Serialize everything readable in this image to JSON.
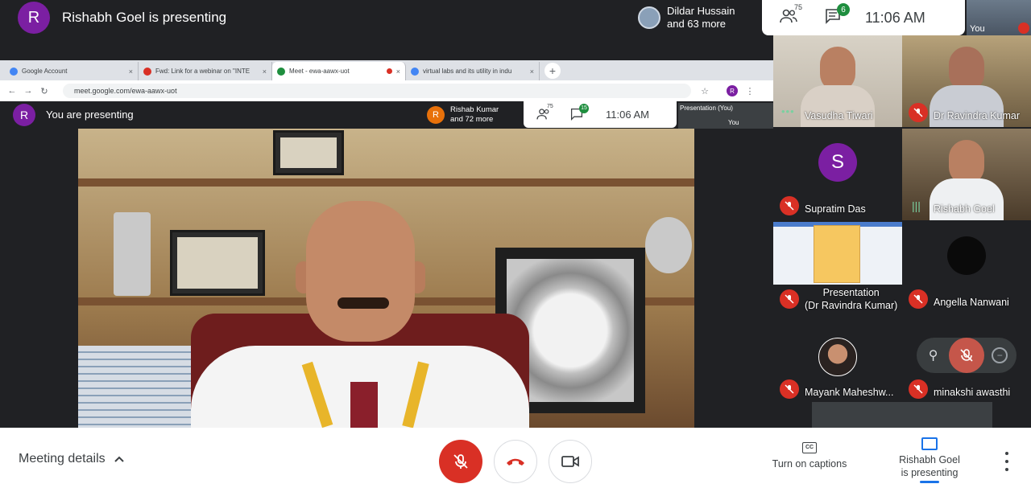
{
  "header": {
    "presenter_initial": "R",
    "presenter_title": "Rishabh Goel is presenting",
    "viewer_name": "Dildar Hussain",
    "viewer_more": "and 63 more",
    "people_count": "75",
    "chat_badge": "6",
    "time": "11:06 AM",
    "self_label": "You"
  },
  "browser": {
    "tabs": [
      {
        "label": "Google Account",
        "color": "#4285f4"
      },
      {
        "label": "Fwd: Link for a webinar on \"INTE",
        "color": "#d93025"
      },
      {
        "label": "Meet - ewa-aawx-uot",
        "color": "#1e8e3e"
      },
      {
        "label": "virtual labs and its utility in indu",
        "color": "#4285f4"
      }
    ],
    "url": "meet.google.com/ewa-aawx-uot",
    "profile_initial": "R"
  },
  "inner_meet": {
    "initial": "R",
    "title": "You are presenting",
    "viewer_initial": "R",
    "viewer_name": "Rishab Kumar",
    "viewer_more": "and 72 more",
    "people_count": "75",
    "chat_badge": "15",
    "time": "11:06 AM",
    "presentation_label": "Presentation (You)",
    "you_label": "You"
  },
  "participants": [
    {
      "name": "Vasudha Tiwari"
    },
    {
      "name": "Dr Ravindra Kumar"
    },
    {
      "name": "Supratim Das",
      "initial": "S"
    },
    {
      "name": "Rishabh Goel"
    },
    {
      "name": "Presentation",
      "name2": "(Dr Ravindra Kumar)"
    },
    {
      "name": "Angella Nanwani"
    },
    {
      "name": "Mayank Maheshw..."
    },
    {
      "name": "minakshi awasthi"
    }
  ],
  "bottom": {
    "meeting_details": "Meeting details",
    "captions_label": "Turn on captions",
    "presenting_line1": "Rishabh Goel",
    "presenting_line2": "is presenting"
  },
  "colors": {
    "accent": "#1a73e8",
    "danger": "#d93025",
    "avatar_purple": "#7b1fa2",
    "chat_badge_green": "#1e8e3e"
  }
}
